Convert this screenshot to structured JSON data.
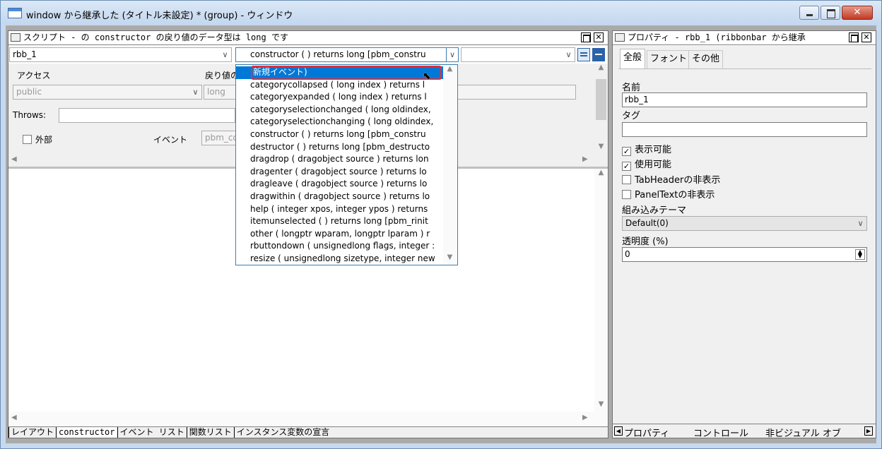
{
  "window": {
    "title": "window から継承した (タイトル未設定) * (group) - ウィンドウ",
    "close_glyph": "✕"
  },
  "script": {
    "header": "スクリプト -  の constructor の戻り値のデータ型は long です",
    "object_combo": "rbb_1",
    "event_combo": "constructor ( ) returns long [pbm_constru",
    "access_label": "アクセス",
    "access_value": "public",
    "return_label": "戻り値の",
    "return_value": "long",
    "throws_label": "Throws:",
    "external_label": "外部",
    "event_label": "イベント",
    "event_value": "pbm_co",
    "tabs": [
      "レイアウト",
      "constructor",
      "イベント リスト",
      "関数リスト",
      "インスタンス変数の宣言"
    ]
  },
  "dropdown": {
    "items": [
      "新規イベント)",
      "categorycollapsed ( long index ) returns l",
      "categoryexpanded ( long index ) returns l",
      "categoryselectionchanged ( long oldindex,",
      "categoryselectionchanging ( long oldindex,",
      "constructor ( ) returns long [pbm_constru",
      "destructor ( ) returns long [pbm_destructo",
      "dragdrop ( dragobject source ) returns lon",
      "dragenter ( dragobject source ) returns lo",
      "dragleave ( dragobject source ) returns lo",
      "dragwithin ( dragobject source ) returns lo",
      "help ( integer xpos, integer ypos ) returns",
      "itemunselected ( ) returns long [pbm_rinit",
      "other ( longptr wparam, longptr lparam ) r",
      "rbuttondown ( unsignedlong flags, integer :",
      "resize ( unsignedlong sizetype, integer new"
    ]
  },
  "properties": {
    "header": "プロパティ -  rbb_1  (ribbonbar から継承",
    "tabs": [
      "全般",
      "フォント",
      "その他"
    ],
    "name_label": "名前",
    "name_value": "rbb_1",
    "tag_label": "タグ",
    "tag_value": "",
    "visible_label": "表示可能",
    "visible_checked": true,
    "enabled_label": "使用可能",
    "enabled_checked": true,
    "tabheader_label": "TabHeaderの非表示",
    "paneltext_label": "PanelTextの非表示",
    "theme_label": "組み込みテーマ",
    "theme_value": "Default(0)",
    "transparency_label": "透明度 (%)",
    "transparency_value": "0",
    "bottom_tabs": [
      "プロパティ",
      "コントロール",
      "非ビジュアル オブ"
    ]
  },
  "colors": {
    "selection": "#0078d7",
    "highlight_box": "#e0303a"
  }
}
